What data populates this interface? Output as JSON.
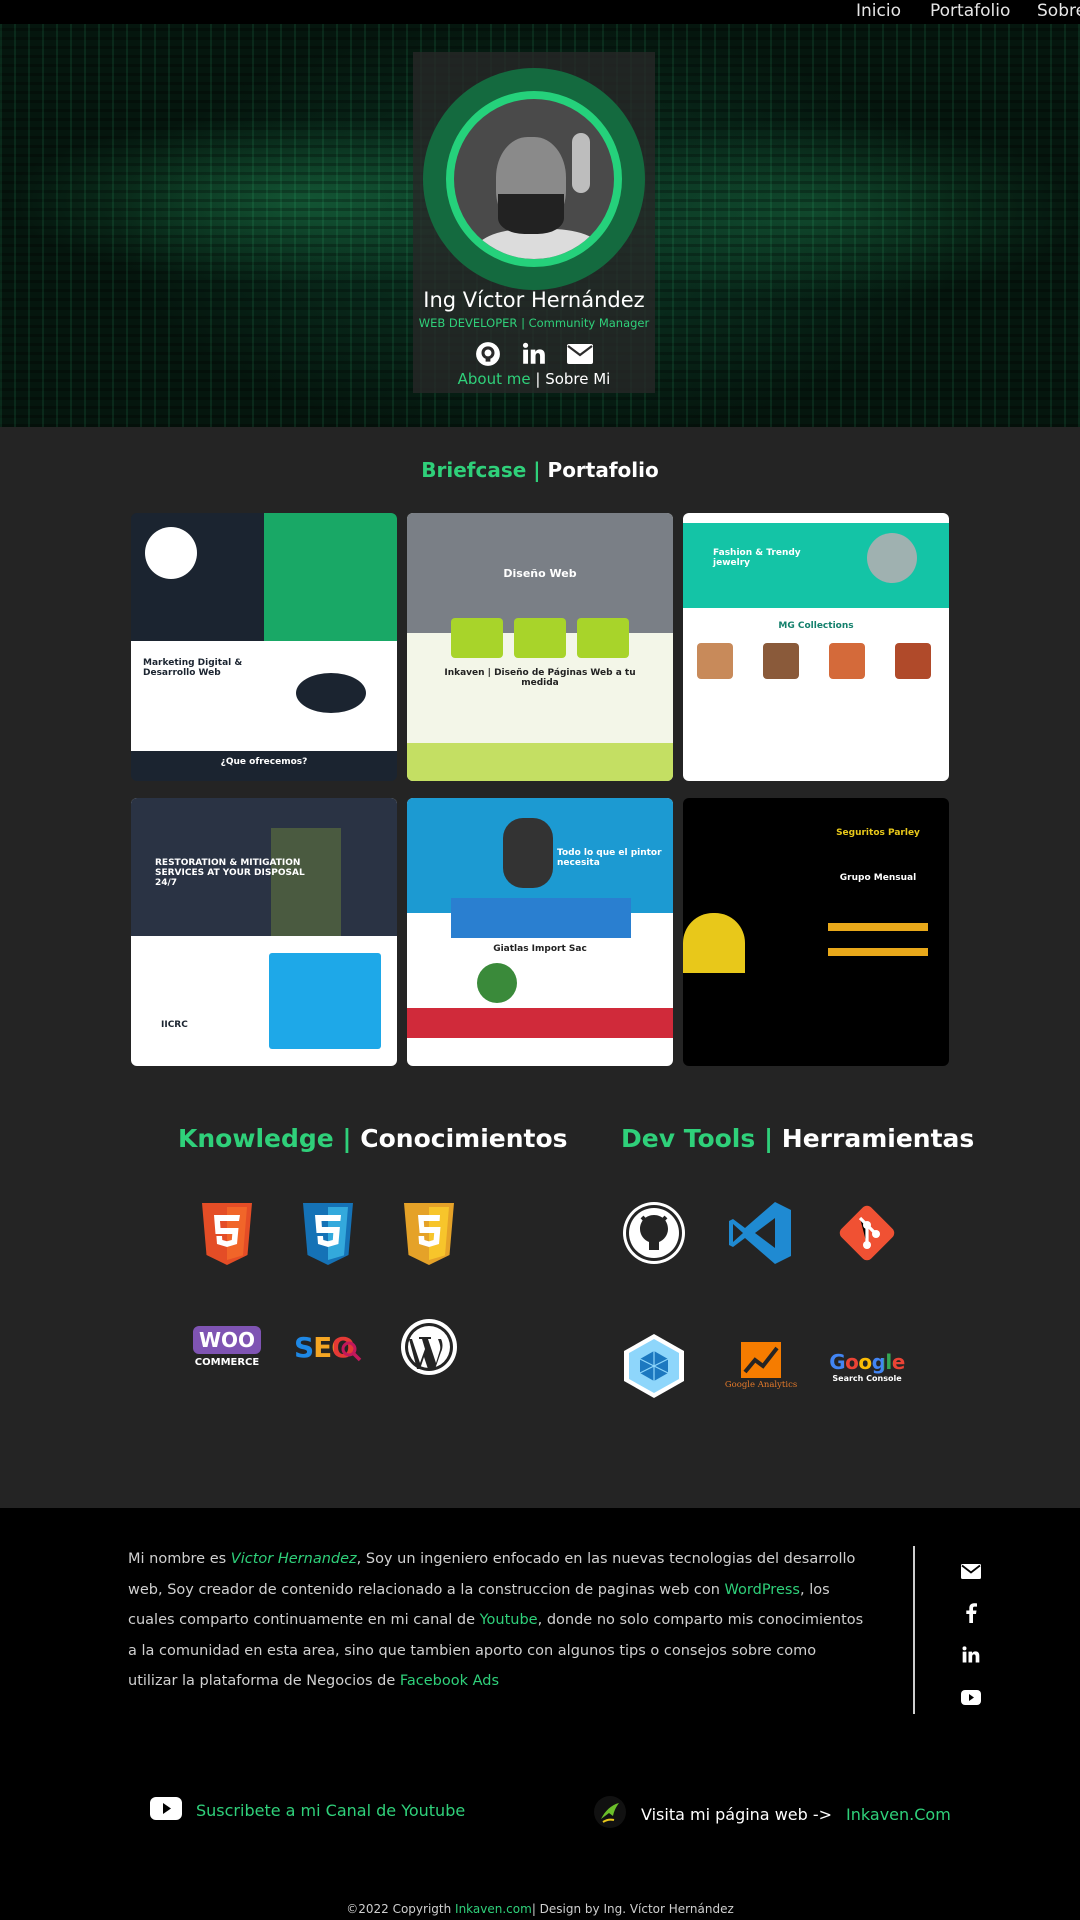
{
  "nav": {
    "items": [
      "Inicio",
      "Portafolio",
      "Sobre"
    ]
  },
  "profile": {
    "name": "Ing Víctor Hernández",
    "role": "WEB DEVELOPER | Community Manager",
    "about_green": "About me",
    "about_sep": " | ",
    "about_white": "Sobre Mi",
    "social_icons": [
      "github-icon",
      "linkedin-icon",
      "mail-icon"
    ]
  },
  "portfolio": {
    "title_green": "Briefcase",
    "title_sep": " | ",
    "title_white": "Portafolio",
    "cards": [
      {
        "caption": "Marketing Digital & Desarrollo Web",
        "subcaption": "¿Que ofrecemos?"
      },
      {
        "caption": "Diseño Web",
        "subcaption": "Inkaven | Diseño de Páginas Web a tu medida"
      },
      {
        "caption": "Fashion & Trendy jewelry",
        "subcaption": "MG Collections"
      },
      {
        "caption": "RESTORATION & MITIGATION SERVICES AT YOUR DISPOSAL 24/7",
        "subcaption": "IICRC"
      },
      {
        "caption": "Todo lo que el pintor necesita",
        "subcaption": "Giatlas Import Sac"
      },
      {
        "caption": "Seguritos Parley",
        "subcaption": "Grupo Mensual"
      }
    ]
  },
  "knowledge": {
    "title_green": "Knowledge",
    "title_sep": " | ",
    "title_white": "Conocimientos",
    "logos": [
      "html5-icon",
      "css3-icon",
      "javascript-icon",
      "woocommerce-icon",
      "seo-icon",
      "wordpress-icon"
    ],
    "woo_text": "WOO",
    "commerce_text": "COMMERCE",
    "seo_text": "SEO"
  },
  "devtools": {
    "title_green": "Dev Tools",
    "title_sep": " | ",
    "title_white": "Herramientas",
    "logos": [
      "github-icon",
      "vscode-icon",
      "git-icon",
      "webpack-icon",
      "google-analytics-icon",
      "google-search-console-icon"
    ],
    "ga_text": "Google Analytics",
    "google_text": "Google",
    "gsc_text": "Search Console"
  },
  "footer": {
    "bio": {
      "p1": "Mi nombre es ",
      "name": "Victor Hernandez",
      "p2": ", Soy un ingeniero enfocado en las nuevas tecnologias del desarrollo web, Soy creador de contenido relacionado a la construccion de paginas web con ",
      "wordpress": "WordPress",
      "p3": ", los cuales comparto continuamente en mi canal de ",
      "youtube": "Youtube",
      "p4": ", donde no solo comparto mis conocimientos a la comunidad en esta area, sino que tambien aporto con algunos tips o consejos sobre como utilizar la plataforma de Negocios de ",
      "facebook": "Facebook Ads"
    },
    "side_icons": [
      "mail-icon",
      "facebook-icon",
      "linkedin-icon",
      "youtube-icon"
    ],
    "youtube_cta": "Suscribete a mi Canal de Youtube",
    "web_cta_white": "Visita mi página web ->",
    "web_cta_green": "Inkaven.Com",
    "copyright_pre": "©2022 Copyrigth ",
    "copyright_link": "Inkaven.com",
    "copyright_post": "| Design by Ing. Víctor Hernández"
  },
  "colors": {
    "accent": "#2fd07a",
    "background": "#242424",
    "footer": "#000000"
  }
}
